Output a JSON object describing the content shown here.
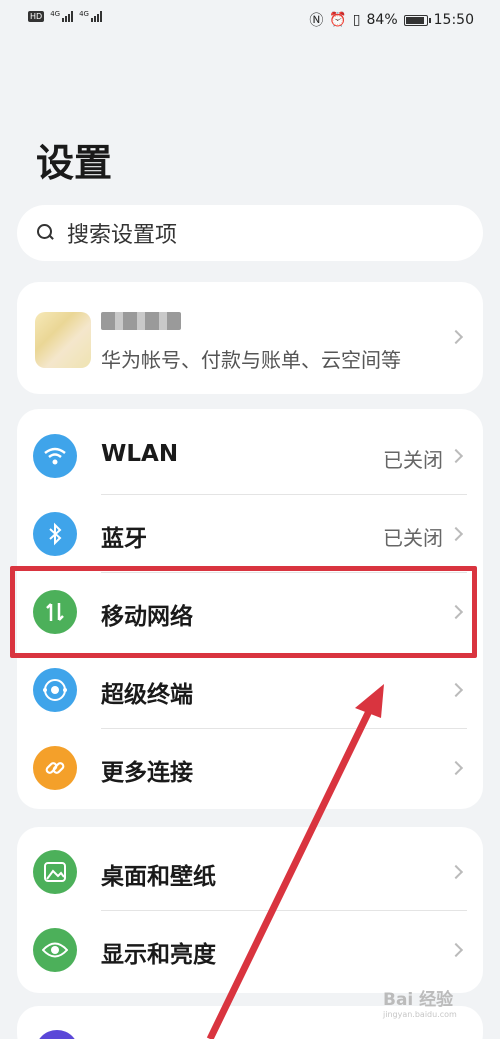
{
  "status_bar": {
    "network_1": "4G",
    "network_2": "4G",
    "battery": "84%",
    "time": "15:50"
  },
  "page_title": "设置",
  "search": {
    "placeholder": "搜索设置项"
  },
  "account": {
    "subtitle": "华为帐号、付款与账单、云空间等"
  },
  "connectivity": [
    {
      "label": "WLAN",
      "value": "已关闭",
      "icon": "wifi-icon",
      "color": "#3fa4ea"
    },
    {
      "label": "蓝牙",
      "value": "已关闭",
      "icon": "bluetooth-icon",
      "color": "#3fa4ea"
    },
    {
      "label": "移动网络",
      "value": "",
      "icon": "mobile-data-icon",
      "color": "#4cb05a"
    },
    {
      "label": "超级终端",
      "value": "",
      "icon": "super-device-icon",
      "color": "#3fa4ea"
    },
    {
      "label": "更多连接",
      "value": "",
      "icon": "link-icon",
      "color": "#f4a02a"
    }
  ],
  "display": [
    {
      "label": "桌面和壁纸",
      "icon": "wallpaper-icon",
      "color": "#4cb05a"
    },
    {
      "label": "显示和亮度",
      "icon": "eye-icon",
      "color": "#4cb05a"
    }
  ],
  "watermark": {
    "text": "Bai 经验",
    "sub": "jingyan.baidu.com"
  },
  "colors": {
    "highlight": "#d9343f",
    "background": "#f1f3f5"
  }
}
